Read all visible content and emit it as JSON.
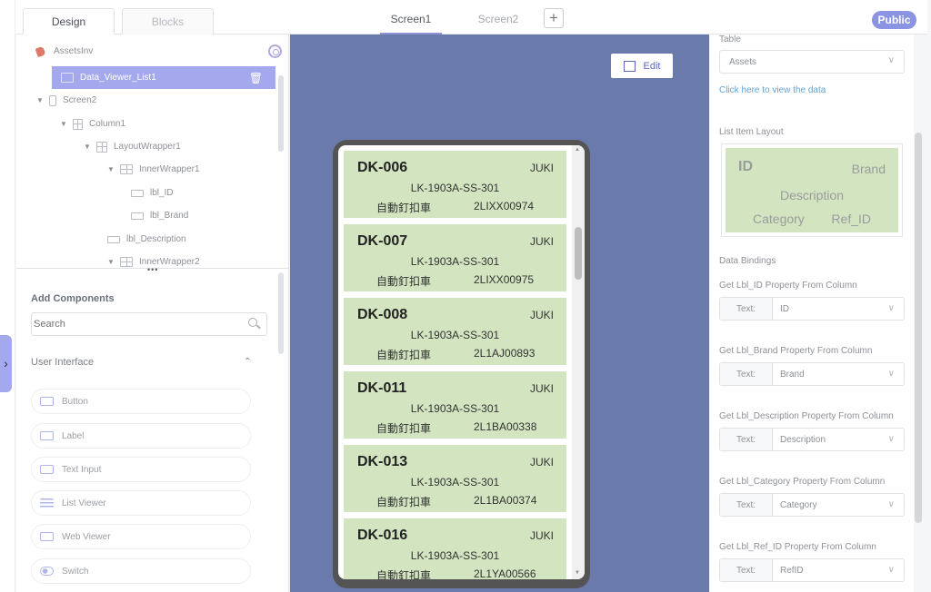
{
  "top_tabs": {
    "design": "Design",
    "blocks": "Blocks"
  },
  "screen_tabs": [
    "Screen1",
    "Screen2"
  ],
  "add_screen": "+",
  "public_label": "Public",
  "tree": {
    "root": "AssetsInv",
    "selected": "Data_Viewer_List1",
    "items": [
      "Screen2",
      "Column1",
      "LayoutWrapper1",
      "InnerWrapper1",
      "lbl_ID",
      "lbl_Brand",
      "lbl_Description",
      "InnerWrapper2"
    ],
    "more": "•••"
  },
  "add_components": {
    "title": "Add Components",
    "search_placeholder": "Search",
    "section": "User Interface",
    "items": [
      "Button",
      "Label",
      "Text Input",
      "List Viewer",
      "Web Viewer",
      "Switch"
    ]
  },
  "canvas": {
    "edit_label": "Edit"
  },
  "list_items": [
    {
      "id": "DK-006",
      "brand": "JUKI",
      "description": "LK-1903A-SS-301",
      "category": "自動釘扣車",
      "ref_id": "2LIXX00974"
    },
    {
      "id": "DK-007",
      "brand": "JUKI",
      "description": "LK-1903A-SS-301",
      "category": "自動釘扣車",
      "ref_id": "2LIXX00975"
    },
    {
      "id": "DK-008",
      "brand": "JUKI",
      "description": "LK-1903A-SS-301",
      "category": "自動釘扣車",
      "ref_id": "2L1AJ00893"
    },
    {
      "id": "DK-011",
      "brand": "JUKI",
      "description": "LK-1903A-SS-301",
      "category": "自動釘扣車",
      "ref_id": "2L1BA00338"
    },
    {
      "id": "DK-013",
      "brand": "JUKI",
      "description": "LK-1903A-SS-301",
      "category": "自動釘扣車",
      "ref_id": "2L1BA00374"
    },
    {
      "id": "DK-016",
      "brand": "JUKI",
      "description": "LK-1903A-SS-301",
      "category": "自動釘扣車",
      "ref_id": "2L1YA00566"
    }
  ],
  "properties": {
    "table_label": "Table",
    "table_value": "Assets",
    "view_data_link": "Click here to view the data",
    "layout_label": "List Item Layout",
    "layout": {
      "id": "ID",
      "brand": "Brand",
      "description": "Description",
      "category": "Category",
      "ref_id": "Ref_ID"
    },
    "bindings_label": "Data Bindings",
    "bindings": [
      {
        "label": "Get Lbl_ID Property From Column",
        "prop": "Text:",
        "value": "ID"
      },
      {
        "label": "Get Lbl_Brand Property From Column",
        "prop": "Text:",
        "value": "Brand"
      },
      {
        "label": "Get Lbl_Description Property From Column",
        "prop": "Text:",
        "value": "Description"
      },
      {
        "label": "Get Lbl_Category Property From Column",
        "prop": "Text:",
        "value": "Category"
      },
      {
        "label": "Get Lbl_Ref_ID Property From Column",
        "prop": "Text:",
        "value": "RefID"
      }
    ]
  },
  "colors": {
    "accent": "#8b93e3",
    "canvas": "#6a7bab",
    "card": "#d3e5c0",
    "selected_row": "#a3a9ec",
    "link": "#5fa4d6"
  }
}
